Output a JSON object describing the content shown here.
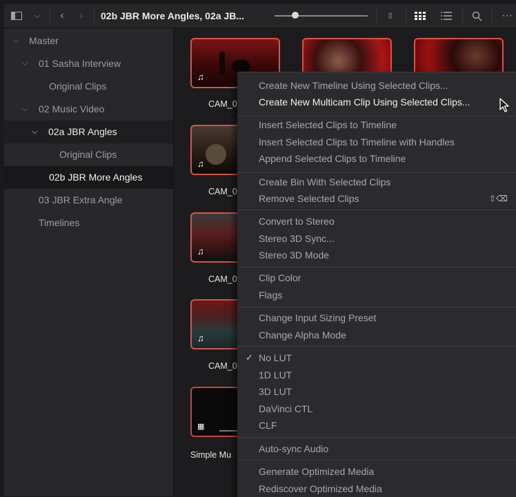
{
  "toolbar": {
    "title": "02b JBR More Angles, 02a JB...",
    "icons": [
      "sidebar-toggle-icon",
      "chevron-down-icon",
      "back-icon",
      "forward-icon",
      "sort-icon",
      "grid-view-icon",
      "list-view-icon",
      "search-icon",
      "more-icon"
    ],
    "zoom_level": 0.22
  },
  "sidebar": {
    "items": [
      {
        "label": "Master"
      },
      {
        "label": "01 Sasha Interview"
      },
      {
        "label": "Original Clips"
      },
      {
        "label": "02 Music Video"
      },
      {
        "label": "02a JBR Angles"
      },
      {
        "label": "Original Clips"
      },
      {
        "label": "02b JBR More Angles"
      },
      {
        "label": "03 JBR Extra Angle"
      },
      {
        "label": "Timelines"
      }
    ]
  },
  "clips": [
    {
      "label": "CAM_0"
    },
    {
      "label": "CAM_0"
    },
    {
      "label": "CAM_0"
    },
    {
      "label": "CAM_0"
    },
    {
      "label": "Simple Mu"
    }
  ],
  "context_menu": {
    "groups": [
      [
        {
          "label": "Create New Timeline Using Selected Clips..."
        },
        {
          "label": "Create New Multicam Clip Using Selected Clips..."
        }
      ],
      [
        {
          "label": "Insert Selected Clips to Timeline"
        },
        {
          "label": "Insert Selected Clips to Timeline with Handles"
        },
        {
          "label": "Append Selected Clips to Timeline"
        }
      ],
      [
        {
          "label": "Create Bin With Selected Clips"
        },
        {
          "label": "Remove Selected Clips",
          "shortcut": "⇧⌫"
        }
      ],
      [
        {
          "label": "Convert to Stereo"
        },
        {
          "label": "Stereo 3D Sync..."
        },
        {
          "label": "Stereo 3D Mode"
        }
      ],
      [
        {
          "label": "Clip Color"
        },
        {
          "label": "Flags"
        }
      ],
      [
        {
          "label": "Change Input Sizing Preset"
        },
        {
          "label": "Change Alpha Mode"
        }
      ],
      [
        {
          "label": "No LUT",
          "checked": true
        },
        {
          "label": "1D LUT"
        },
        {
          "label": "3D LUT"
        },
        {
          "label": "DaVinci CTL"
        },
        {
          "label": "CLF"
        }
      ],
      [
        {
          "label": "Auto-sync Audio"
        }
      ],
      [
        {
          "label": "Generate Optimized Media"
        },
        {
          "label": "Rediscover Optimized Media"
        }
      ]
    ]
  },
  "colors": {
    "selection_border": "#d9534a",
    "background": "#1c1c1e",
    "menu": "#2b2b2e"
  }
}
